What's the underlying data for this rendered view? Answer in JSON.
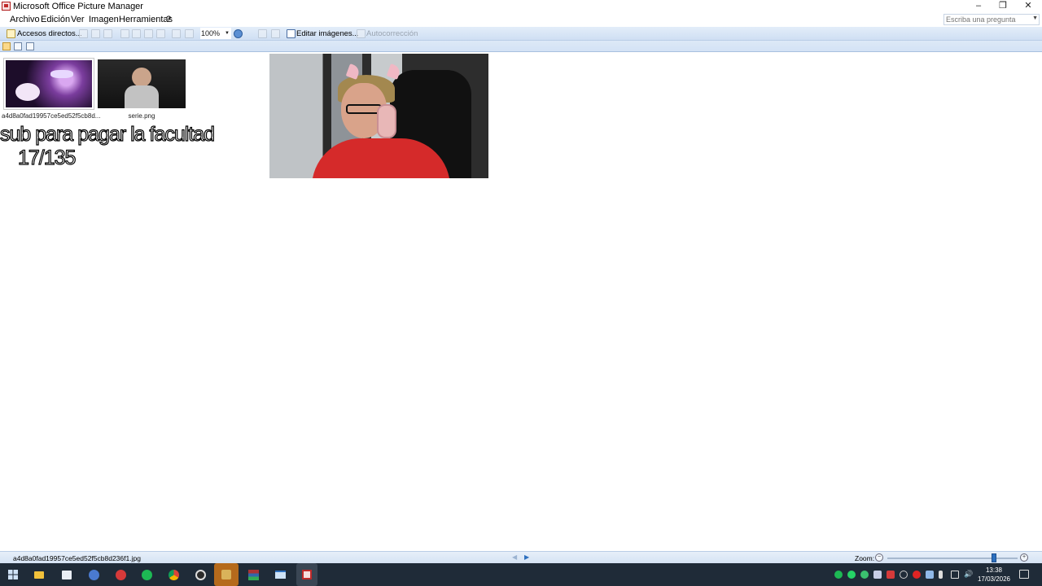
{
  "window": {
    "title": "Microsoft Office Picture Manager",
    "controls": {
      "minimize": "–",
      "restore": "❐",
      "close": "✕"
    }
  },
  "menu": {
    "items": [
      "Archivo",
      "Edición",
      "Ver",
      "Imagen",
      "Herramientas",
      "?"
    ],
    "help_placeholder": "Escriba una pregunta"
  },
  "toolbar": {
    "shortcuts_label": "Accesos directos...",
    "zoom_value": "100%",
    "edit_images_label": "Editar imágenes...",
    "autocorrect_label": "Autocorrección"
  },
  "thumbnails": [
    {
      "caption": "a4d8a0fad19957ce5ed52f5cb8d...",
      "selected": true
    },
    {
      "caption": "serie.png",
      "selected": false
    }
  ],
  "overlay": {
    "line1": "sub para pagar la facultad",
    "line2": "17/135"
  },
  "status": {
    "filename": "a4d8a0fad19957ce5ed52f5cb8d236f1.jpg",
    "zoom_label": "Zoom:",
    "zoom_level_fraction": 0.82
  },
  "taskbar": {
    "time": "13:38",
    "date": "17/03/2026"
  },
  "colors": {
    "accent": "#2c6fbe",
    "taskbar": "#1f2b38",
    "toolbar": "#d3e2f5"
  }
}
